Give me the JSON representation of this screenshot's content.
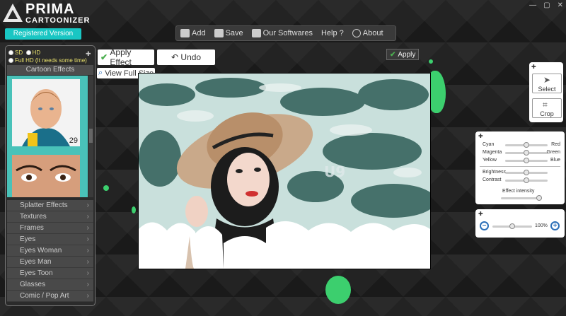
{
  "app": {
    "title_line1": "PRIMA",
    "title_line2": "CARTOONIZER",
    "registered": "Registered Version"
  },
  "window_controls": [
    "✕",
    "▢",
    "—"
  ],
  "toolbar": {
    "add": "Add",
    "save": "Save",
    "our_softwares": "Our Softwares",
    "help": "Help ?",
    "about": "About"
  },
  "resolution": {
    "sd": "SD",
    "hd": "HD",
    "fullhd": "Full HD (It needs some time)"
  },
  "left_panel": {
    "header": "Cartoon Effects",
    "thumb_number": "29",
    "menu": [
      "Splatter Effects",
      "Textures",
      "Frames",
      "Eyes",
      "Eyes Woman",
      "Eyes Man",
      "Eyes Toon",
      "Glasses",
      "Comic / Pop Art"
    ]
  },
  "actions": {
    "apply_effect": "Apply Effect",
    "undo": "Undo",
    "view_full_size": "View Full Size",
    "apply": "Apply"
  },
  "tools": {
    "select": "Select",
    "crop": "Crop"
  },
  "color_balance": [
    {
      "left": "Cyan",
      "right": "Red",
      "value": 0.5
    },
    {
      "left": "Magenta",
      "right": "Green",
      "value": 0.5
    },
    {
      "left": "Yellow",
      "right": "Blue",
      "value": 0.5
    }
  ],
  "adjust": [
    {
      "label": "Brightness",
      "value": 0.5
    },
    {
      "label": "Contrast",
      "value": 0.5
    }
  ],
  "intensity": {
    "label": "Effect intensity",
    "value": 1.0
  },
  "zoom": {
    "value_label": "100%",
    "value": 0.5
  },
  "colors": {
    "accent": "#19c6c3",
    "splash": "#3ccf6e",
    "zoom": "#2b6fb8"
  }
}
